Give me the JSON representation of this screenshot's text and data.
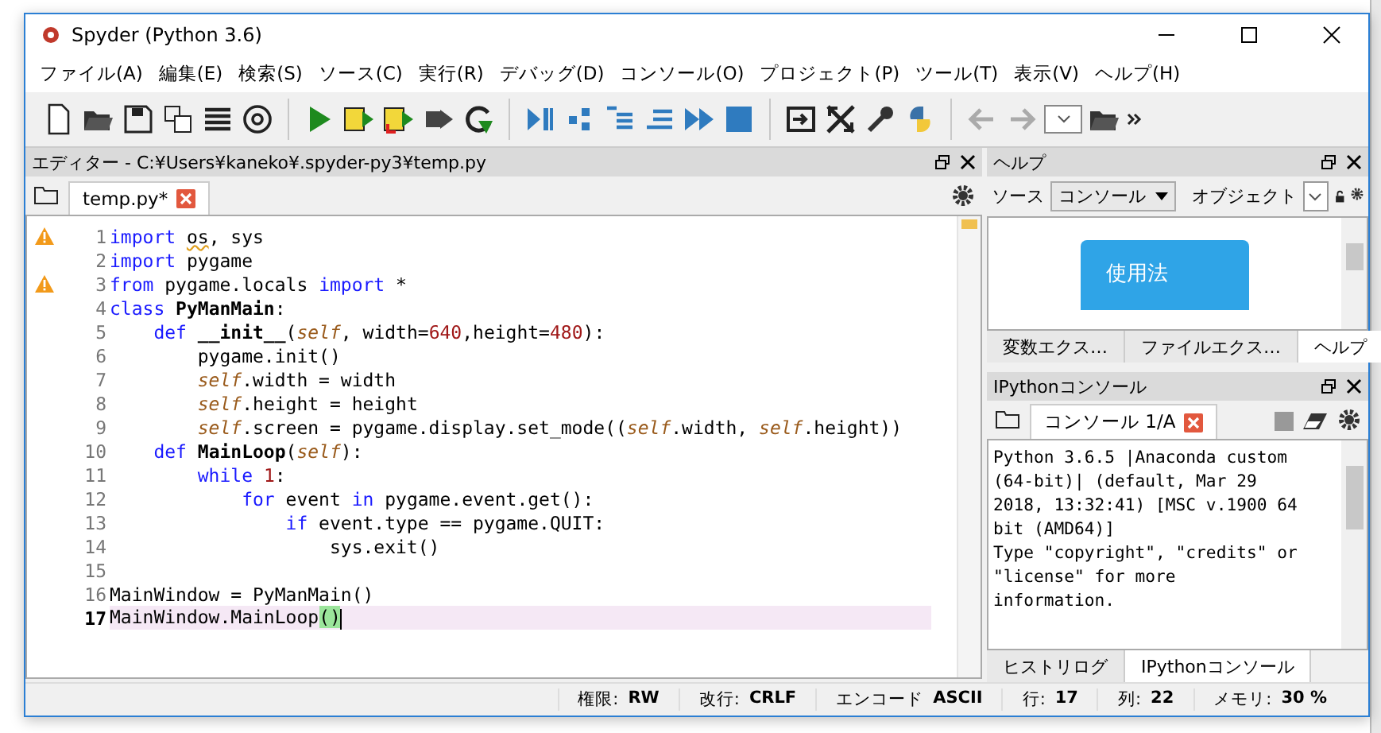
{
  "window": {
    "title": "Spyder (Python 3.6)"
  },
  "menu": [
    "ファイル(A)",
    "編集(E)",
    "検索(S)",
    "ソース(C)",
    "実行(R)",
    "デバッグ(D)",
    "コンソール(O)",
    "プロジェクト(P)",
    "ツール(T)",
    "表示(V)",
    "ヘルプ(H)"
  ],
  "editor": {
    "title": "エディター - C:¥Users¥kaneko¥.spyder-py3¥temp.py",
    "tabs": [
      {
        "label": "temp.py*",
        "selected": true
      }
    ],
    "lines": [
      {
        "number": "1",
        "warning": true,
        "current": false,
        "tokens": [
          {
            "text": "import ",
            "kind": "keyword"
          },
          {
            "text": "os",
            "kind": "squiggle"
          },
          {
            "text": ", sys",
            "kind": "plain"
          }
        ]
      },
      {
        "number": "2",
        "warning": false,
        "current": false,
        "tokens": [
          {
            "text": "import",
            "kind": "keyword"
          },
          {
            "text": " pygame",
            "kind": "plain"
          }
        ]
      },
      {
        "number": "3",
        "warning": true,
        "current": false,
        "tokens": [
          {
            "text": "from",
            "kind": "keyword"
          },
          {
            "text": " pygame.locals ",
            "kind": "plain"
          },
          {
            "text": "import",
            "kind": "keyword"
          },
          {
            "text": " *",
            "kind": "plain"
          }
        ]
      },
      {
        "number": "4",
        "warning": false,
        "current": false,
        "tokens": [
          {
            "text": "class ",
            "kind": "keyword"
          },
          {
            "text": "PyManMain",
            "kind": "name"
          },
          {
            "text": ":",
            "kind": "plain"
          }
        ]
      },
      {
        "number": "5",
        "warning": false,
        "current": false,
        "tokens": [
          {
            "text": "    def ",
            "kind": "keyword"
          },
          {
            "text": "__init__",
            "kind": "name"
          },
          {
            "text": "(",
            "kind": "plain"
          },
          {
            "text": "self",
            "kind": "self"
          },
          {
            "text": ", width=",
            "kind": "plain"
          },
          {
            "text": "640",
            "kind": "number"
          },
          {
            "text": ",height=",
            "kind": "plain"
          },
          {
            "text": "480",
            "kind": "number"
          },
          {
            "text": "):",
            "kind": "plain"
          }
        ]
      },
      {
        "number": "6",
        "warning": false,
        "current": false,
        "tokens": [
          {
            "text": "        pygame.init()",
            "kind": "plain"
          }
        ]
      },
      {
        "number": "7",
        "warning": false,
        "current": false,
        "tokens": [
          {
            "text": "        self",
            "kind": "self"
          },
          {
            "text": ".width = width",
            "kind": "plain"
          }
        ]
      },
      {
        "number": "8",
        "warning": false,
        "current": false,
        "tokens": [
          {
            "text": "        self",
            "kind": "self"
          },
          {
            "text": ".height = height",
            "kind": "plain"
          }
        ]
      },
      {
        "number": "9",
        "warning": false,
        "current": false,
        "tokens": [
          {
            "text": "        self",
            "kind": "self"
          },
          {
            "text": ".screen = pygame.display.set_mode((",
            "kind": "plain"
          },
          {
            "text": "self",
            "kind": "self"
          },
          {
            "text": ".width, ",
            "kind": "plain"
          },
          {
            "text": "self",
            "kind": "self"
          },
          {
            "text": ".height))",
            "kind": "plain"
          }
        ]
      },
      {
        "number": "10",
        "warning": false,
        "current": false,
        "tokens": [
          {
            "text": "    def ",
            "kind": "keyword"
          },
          {
            "text": "MainLoop",
            "kind": "name"
          },
          {
            "text": "(",
            "kind": "plain"
          },
          {
            "text": "self",
            "kind": "self"
          },
          {
            "text": "):",
            "kind": "plain"
          }
        ]
      },
      {
        "number": "11",
        "warning": false,
        "current": false,
        "tokens": [
          {
            "text": "        while ",
            "kind": "keyword"
          },
          {
            "text": "1",
            "kind": "number"
          },
          {
            "text": ":",
            "kind": "plain"
          }
        ]
      },
      {
        "number": "12",
        "warning": false,
        "current": false,
        "tokens": [
          {
            "text": "            for",
            "kind": "keyword"
          },
          {
            "text": " event ",
            "kind": "plain"
          },
          {
            "text": "in",
            "kind": "keyword"
          },
          {
            "text": " pygame.event.get():",
            "kind": "plain"
          }
        ]
      },
      {
        "number": "13",
        "warning": false,
        "current": false,
        "tokens": [
          {
            "text": "                if",
            "kind": "keyword"
          },
          {
            "text": " event.type == pygame.QUIT:",
            "kind": "plain"
          }
        ]
      },
      {
        "number": "14",
        "warning": false,
        "current": false,
        "tokens": [
          {
            "text": "                    sys.exit()",
            "kind": "plain"
          }
        ]
      },
      {
        "number": "15",
        "warning": false,
        "current": false
      },
      {
        "number": "16",
        "warning": false,
        "current": false,
        "tokens": [
          {
            "text": "MainWindow = PyManMain()",
            "kind": "plain"
          }
        ]
      },
      {
        "number": "17",
        "warning": false,
        "current": true,
        "tokens": [
          {
            "text": "MainWindow.MainLoop",
            "kind": "plain"
          },
          {
            "text": "()",
            "kind": "match"
          }
        ]
      }
    ]
  },
  "help": {
    "title": "ヘルプ",
    "source_label": "ソース",
    "source_value": "コンソール",
    "object_label": "オブジェクト",
    "card_title": "使用法",
    "tabs": [
      {
        "label": "変数エクス…",
        "selected": false
      },
      {
        "label": "ファイルエクス…",
        "selected": false
      },
      {
        "label": "ヘルプ",
        "selected": true
      }
    ]
  },
  "console": {
    "title": "IPythonコンソール",
    "tabs": [
      {
        "label": "コンソール 1/A",
        "selected": true
      }
    ],
    "lines": [
      "Python 3.6.5 |Anaconda custom",
      "(64-bit)| (default, Mar 29",
      "2018, 13:32:41) [MSC v.1900 64",
      "bit (AMD64)]",
      "Type \"copyright\", \"credits\" or",
      "\"license\" for more",
      "information."
    ],
    "bottom_tabs": [
      {
        "label": "ヒストリログ",
        "selected": false
      },
      {
        "label": "IPythonコンソール",
        "selected": true
      }
    ]
  },
  "status_bar": [
    {
      "label": "権限:",
      "value": "RW"
    },
    {
      "label": "改行:",
      "value": "CRLF"
    },
    {
      "label": "エンコード",
      "value": "ASCII"
    },
    {
      "label": "行:",
      "value": "17"
    },
    {
      "label": "列:",
      "value": "22"
    },
    {
      "label": "メモリ:",
      "value": "30 %"
    }
  ]
}
